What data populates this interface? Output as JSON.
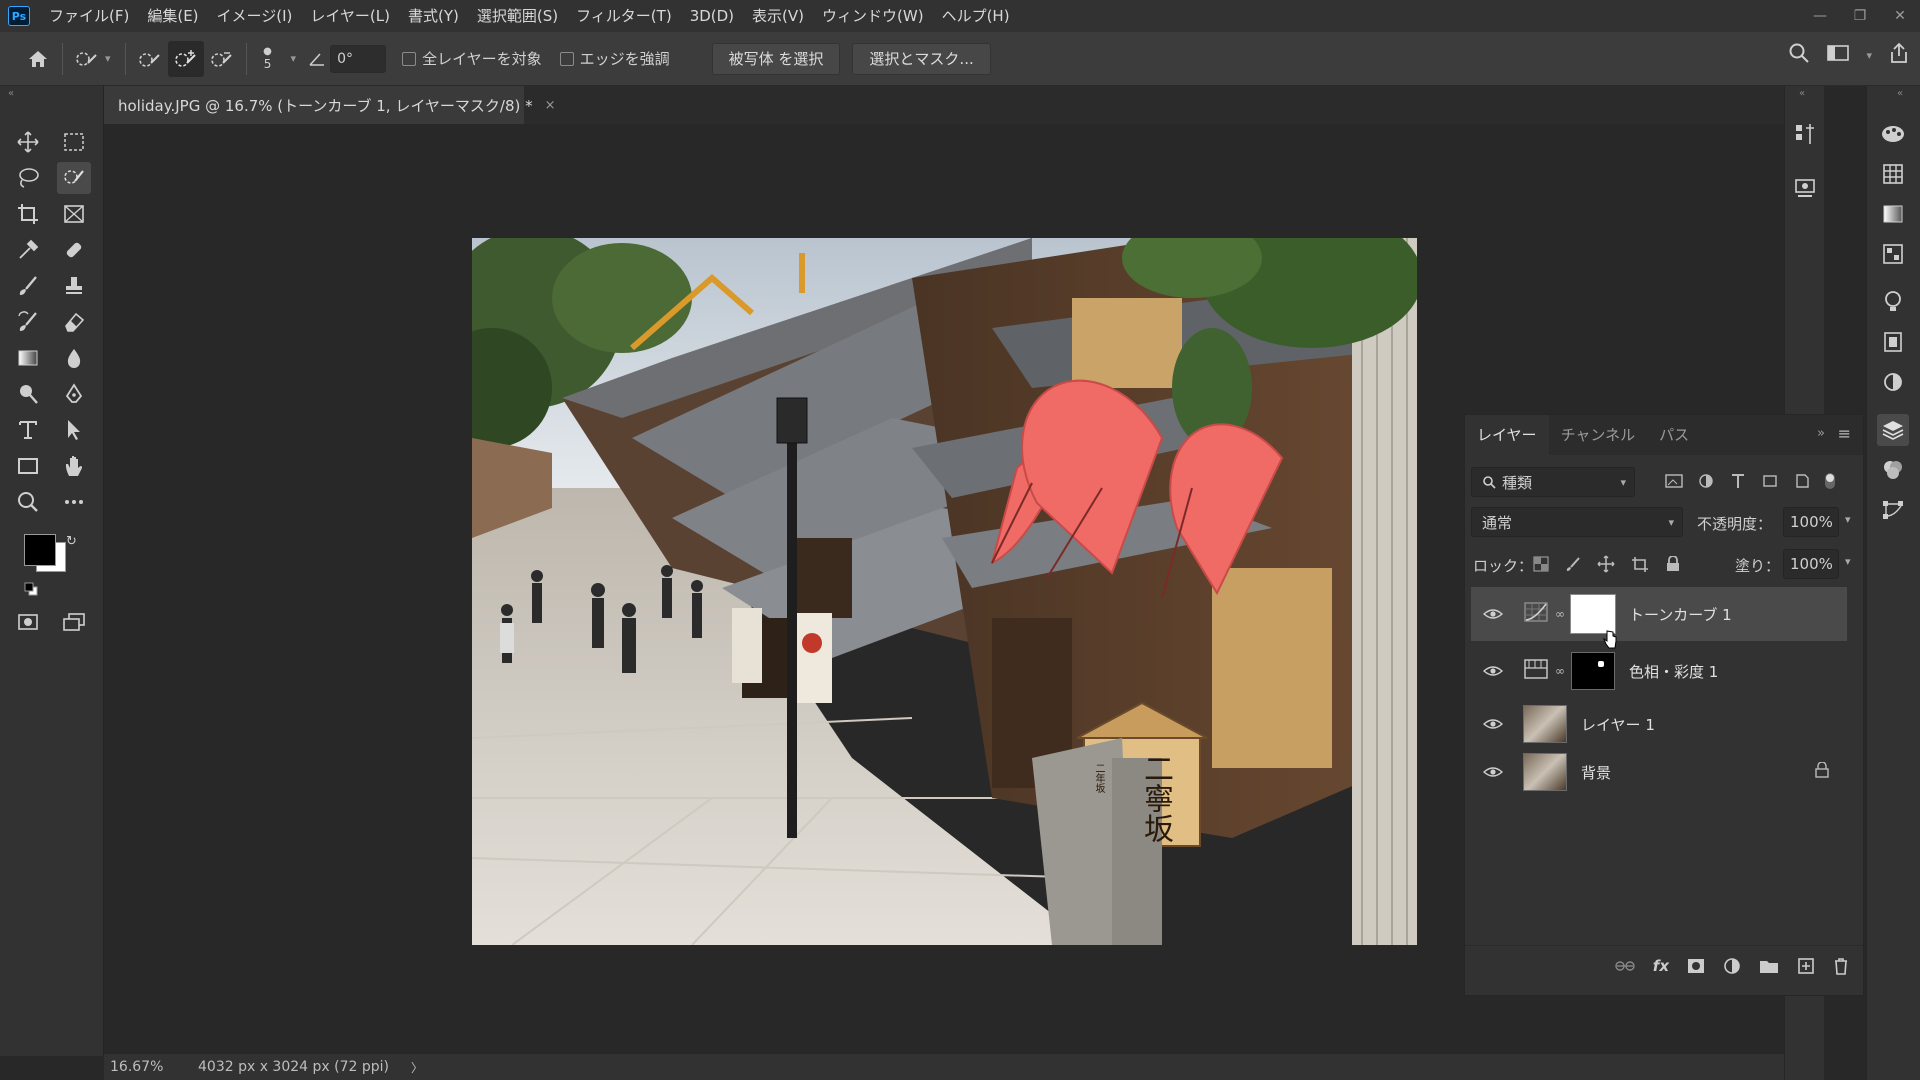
{
  "app": {
    "logo": "Ps"
  },
  "menu": [
    "ファイル(F)",
    "編集(E)",
    "イメージ(I)",
    "レイヤー(L)",
    "書式(Y)",
    "選択範囲(S)",
    "フィルター(T)",
    "3D(D)",
    "表示(V)",
    "ウィンドウ(W)",
    "ヘルプ(H)"
  ],
  "options": {
    "brush_size": "5",
    "angle_value": "0°",
    "sample_all_label": "全レイヤーを対象",
    "enhance_edge_label": "エッジを強調",
    "select_subject_label": "被写体 を選択",
    "select_mask_label": "選択とマスク..."
  },
  "document": {
    "tab_title": "holiday.JPG @ 16.7% (トーンカーブ 1, レイヤーマスク/8) *",
    "close_glyph": "×"
  },
  "status": {
    "zoom": "16.67%",
    "doc_info": "4032 px x 3024 px (72 ppi)",
    "arrow": "〉"
  },
  "layers_panel": {
    "tabs": [
      "レイヤー",
      "チャンネル",
      "パス"
    ],
    "filter_label": "種類",
    "blend_mode": "通常",
    "opacity_label": "不透明度：",
    "opacity_value": "100%",
    "lock_label": "ロック：",
    "fill_label": "塗り：",
    "fill_value": "100%",
    "layers": [
      {
        "name": "トーンカーブ 1",
        "selected": true
      },
      {
        "name": "色相・彩度 1",
        "selected": false
      },
      {
        "name": "レイヤー 1",
        "selected": false
      },
      {
        "name": "背景",
        "selected": false
      }
    ]
  },
  "sign": {
    "text": "二寧坂",
    "small": "二年坂"
  },
  "colors": {
    "accent": "#31a8ff",
    "umbrella": "#f06a66",
    "foreground": "#000000",
    "background": "#ffffff"
  }
}
